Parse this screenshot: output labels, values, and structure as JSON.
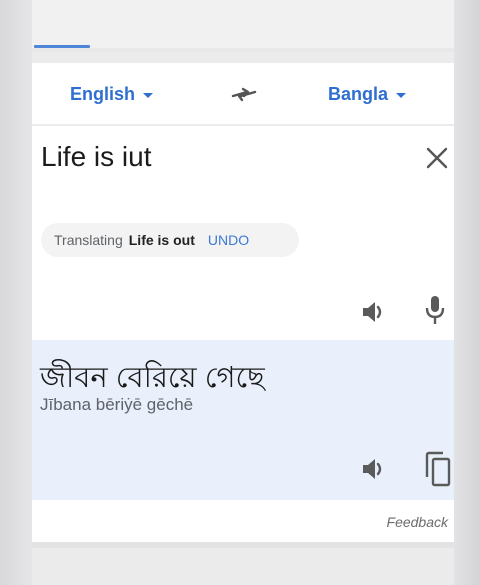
{
  "languages": {
    "source": "English",
    "target": "Bangla"
  },
  "input": {
    "text": "Life is iut"
  },
  "suggestion": {
    "prefix": "Translating",
    "corrected": "Life is out",
    "action": "UNDO"
  },
  "output": {
    "text": "জীবন বেরিয়ে গেছে",
    "transliteration": "Jībana bēriẏē gēchē"
  },
  "footer": {
    "feedback": "Feedback"
  },
  "colors": {
    "accent": "#2f6fd0",
    "output_bg": "#e9f0fb"
  },
  "icons": [
    "swap-icon",
    "close-icon",
    "speaker-icon",
    "microphone-icon",
    "copy-icon"
  ]
}
